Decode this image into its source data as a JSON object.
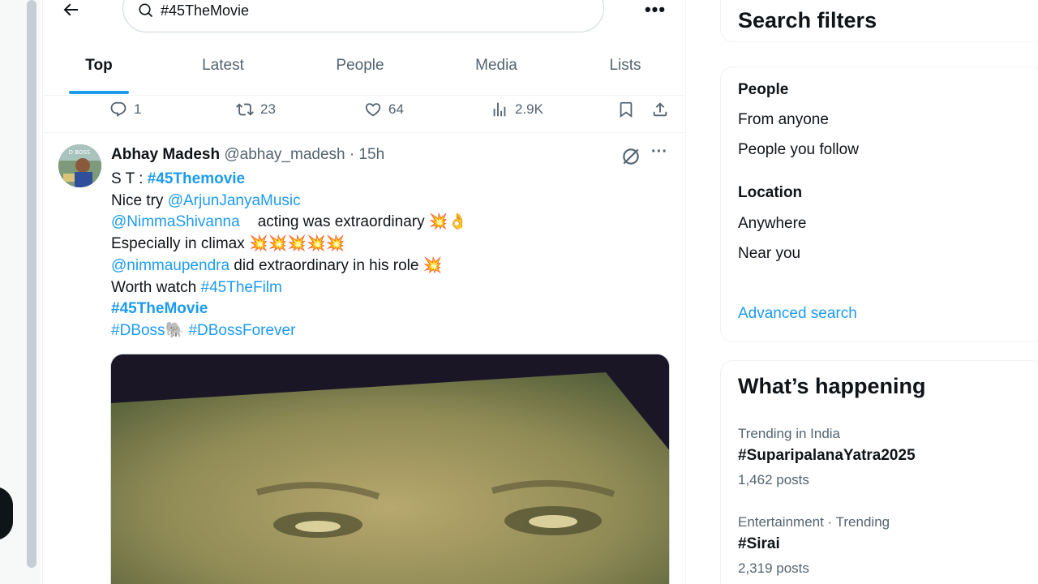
{
  "search": {
    "value": "#45TheMovie"
  },
  "tabs": [
    {
      "label": "Top"
    },
    {
      "label": "Latest"
    },
    {
      "label": "People"
    },
    {
      "label": "Media"
    },
    {
      "label": "Lists"
    }
  ],
  "prev_tweet": {
    "replies": "1",
    "reposts": "23",
    "likes": "64",
    "views": "2.9K"
  },
  "tweet": {
    "display_name": "Abhay Madesh",
    "handle": "@abhay_madesh",
    "separator": "·",
    "time": "15h",
    "avatar_text": "D BOSS",
    "lines": {
      "l1_prefix": "S T : ",
      "l1_tag": "#45Themovie",
      "l2_text": "Nice try ",
      "l2_mention": "@ArjunJanyaMusic",
      "l3_mention": "@NimmaShivanna",
      "l3_text": "acting was extraordinary 💥👌",
      "l4_text": "Especially in climax 💥💥💥💥💥",
      "l5_mention": "@nimmaupendra",
      "l5_text": " did extraordinary in his role 💥",
      "l6_text": "Worth  watch ",
      "l6_tag": "#45TheFilm",
      "l7_tag": "#45TheMovie",
      "l8_tag1": "#DBoss🐘",
      "l8_tag2": " #DBossForever"
    }
  },
  "sidebar": {
    "filters": {
      "title": "Search filters",
      "people_label": "People",
      "people_options": [
        "From anyone",
        "People you follow"
      ],
      "location_label": "Location",
      "location_options": [
        "Anywhere",
        "Near you"
      ],
      "advanced": "Advanced search"
    },
    "happening": {
      "title": "What’s happening",
      "trends": [
        {
          "meta": "Trending in India",
          "name": "#SuparipalanaYatra2025",
          "count": "1,462 posts"
        },
        {
          "meta": "Entertainment · Trending",
          "name": "#Sirai",
          "count": "2,319 posts"
        }
      ]
    }
  },
  "colors": {
    "accent": "#1d9bf0",
    "text": "#0f1419",
    "muted": "#536471",
    "border": "#eff3f4"
  }
}
